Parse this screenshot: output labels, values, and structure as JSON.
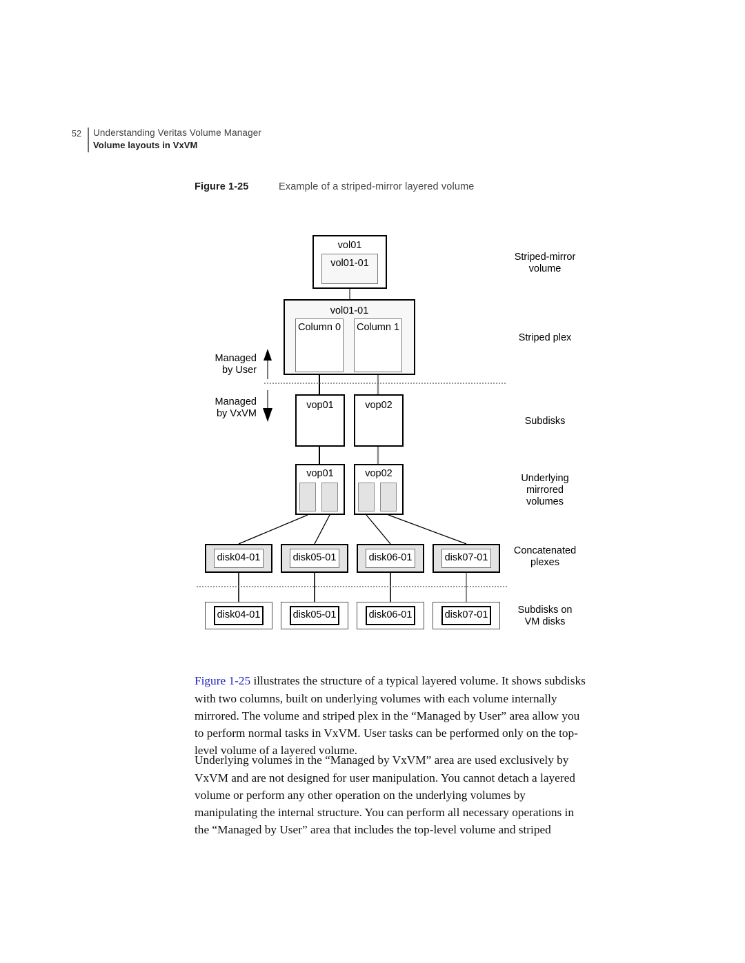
{
  "header": {
    "folio": "52",
    "chapter": "Understanding Veritas Volume Manager",
    "section": "Volume layouts in VxVM"
  },
  "figure": {
    "number": "Figure 1-25",
    "title": "Example of a striped-mirror layered volume"
  },
  "diagram": {
    "volume": {
      "outer_label": "vol01",
      "inner_label": "vol01-01"
    },
    "striped_plex": {
      "label": "vol01-01",
      "columns": [
        "Column 0",
        "Column 1"
      ]
    },
    "subdisks": [
      "vop01",
      "vop02"
    ],
    "mirrored_volumes": [
      "vop01",
      "vop02"
    ],
    "concatenated_plexes": [
      "disk04-01",
      "disk05-01",
      "disk06-01",
      "disk07-01"
    ],
    "vm_disk_subdisks": [
      "disk04-01",
      "disk05-01",
      "disk06-01",
      "disk07-01"
    ],
    "managed_by": {
      "user_line1": "Managed",
      "user_line2": "by User",
      "vxvm_line1": "Managed",
      "vxvm_line2": "by VxVM"
    },
    "side_labels": {
      "striped_mirror_volume_line1": "Striped-mirror",
      "striped_mirror_volume_line2": "volume",
      "striped_plex": "Striped plex",
      "subdisks": "Subdisks",
      "underlying_line1": "Underlying",
      "underlying_line2": "mirrored",
      "underlying_line3": "volumes",
      "concatenated_line1": "Concatenated",
      "concatenated_line2": "plexes",
      "vmdisks_line1": "Subdisks on",
      "vmdisks_line2": "VM disks"
    }
  },
  "body": {
    "paragraph_1_link": "Figure 1-25",
    "paragraph_1_rest": " illustrates the structure of a typical layered volume. It shows subdisks with two columns, built on underlying volumes with each volume internally mirrored. The volume and striped plex in the “Managed by User” area allow you to perform normal tasks in VxVM. User tasks can be performed only on the top-level volume of a layered volume.",
    "paragraph_2": "Underlying volumes in the “Managed by VxVM” area are used exclusively by VxVM and are not designed for user manipulation. You cannot detach a layered volume or perform any other operation on the underlying volumes by manipulating the internal structure. You can perform all necessary operations in the “Managed by User” area that includes the top-level volume and striped"
  }
}
